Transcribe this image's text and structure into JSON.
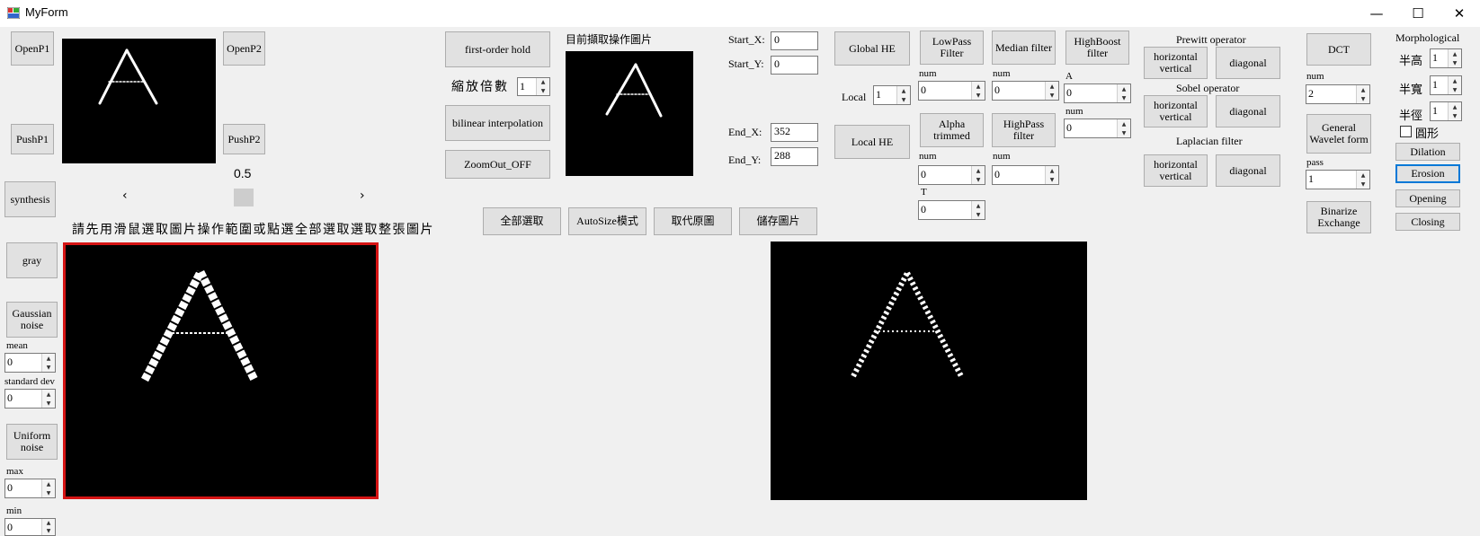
{
  "window": {
    "title": "MyForm",
    "minimize": "—",
    "maximize": "☐",
    "close": "✕"
  },
  "left": {
    "openp1": "OpenP1",
    "openp2": "OpenP2",
    "pushp1": "PushP1",
    "pushp2": "PushP2",
    "synthesis": "synthesis",
    "trackbar_value": "0.5",
    "scroll_left": "‹",
    "scroll_right": "›",
    "instruction": "請先用滑鼠選取圖片操作範圍或點選全部選取選取整張圖片",
    "gray": "gray",
    "gaussian": "Gaussian noise",
    "mean_label": "mean",
    "mean_value": "0",
    "std_label": "standard dev",
    "std_value": "0",
    "uniform": "Uniform noise",
    "max_label": "max",
    "max_value": "0",
    "min_label": "min",
    "min_value": "0"
  },
  "zoom": {
    "first_order": "first-order hold",
    "scale_label": "縮放倍數",
    "scale_value": "1",
    "bilinear": "bilinear interpolation",
    "zoomout": "ZoomOut_OFF",
    "current_label": "目前擷取操作圖片",
    "start_x_label": "Start_X:",
    "start_x": "0",
    "start_y_label": "Start_Y:",
    "start_y": "0",
    "end_x_label": "End_X:",
    "end_x": "352",
    "end_y_label": "End_Y:",
    "end_y": "288"
  },
  "actions": {
    "select_all": "全部選取",
    "autosize": "AutoSize模式",
    "replace": "取代原圖",
    "save": "儲存圖片"
  },
  "filters": {
    "global_he": "Global HE",
    "local_label": "Local",
    "local_value": "1",
    "local_he": "Local HE",
    "lowpass": "LowPass Filter",
    "lowpass_num_label": "num",
    "lowpass_num": "0",
    "median": "Median filter",
    "median_num_label": "num",
    "median_num": "0",
    "highboost": "HighBoost filter",
    "a_label": "A",
    "a_value": "0",
    "hb_num_label": "num",
    "hb_num": "0",
    "alpha": "Alpha trimmed",
    "alpha_num_label": "num",
    "alpha_num": "0",
    "t_label": "T",
    "t_value": "0",
    "highpass": "HighPass filter",
    "highpass_num_label": "num",
    "highpass_num": "0"
  },
  "edges": {
    "prewitt_label": "Prewitt operator",
    "sobel_label": "Sobel operator",
    "laplacian_label": "Laplacian filter",
    "hv": "horizontal vertical",
    "diagonal": "diagonal"
  },
  "transform": {
    "dct": "DCT",
    "num_label": "num",
    "num_value": "2",
    "wavelet": "General Wavelet form",
    "pass_label": "pass",
    "pass_value": "1",
    "binarize": "Binarize Exchange"
  },
  "morph": {
    "title": "Morphological",
    "h_label": "半高",
    "h_value": "1",
    "w_label": "半寬",
    "w_value": "1",
    "r_label": "半徑",
    "r_value": "1",
    "circle_label": "圓形",
    "dilation": "Dilation",
    "erosion": "Erosion",
    "opening": "Opening",
    "closing": "Closing"
  }
}
